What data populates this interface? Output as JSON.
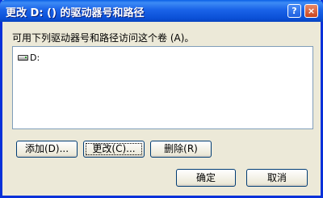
{
  "window": {
    "title": "更改 D: () 的驱动器号和路径",
    "help_label": "?",
    "close_label": "×"
  },
  "dialog": {
    "prompt": "可用下列驱动器号和路径访问这个卷 (A)。",
    "list_items": [
      {
        "label": "D:",
        "icon": "drive-icon"
      }
    ]
  },
  "buttons": {
    "add": "添加(D)...",
    "change": "更改(C)...",
    "remove": "删除(R)",
    "ok": "确定",
    "cancel": "取消"
  }
}
